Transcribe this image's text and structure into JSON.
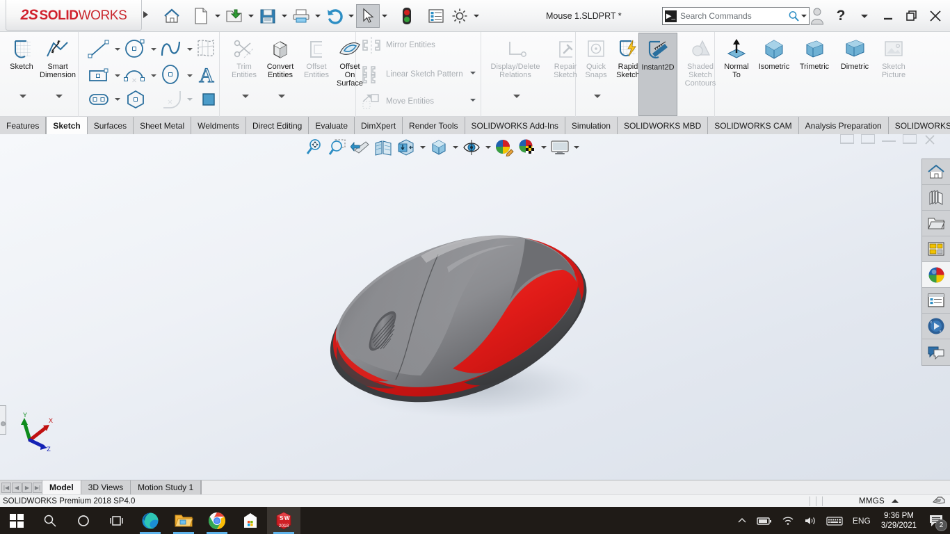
{
  "window": {
    "brand_ds": "2S",
    "brand_solid": "SOLID",
    "brand_works": "WORKS",
    "document_title": "Mouse 1.SLDPRT *",
    "expand_caret": "expand-caret"
  },
  "quick_access": {
    "items": [
      {
        "name": "home-button",
        "label": "Home",
        "dropdown": false
      },
      {
        "name": "new-document-button",
        "label": "New",
        "dropdown": true
      },
      {
        "name": "open-document-button",
        "label": "Open",
        "dropdown": true
      },
      {
        "name": "save-button",
        "label": "Save",
        "dropdown": true
      },
      {
        "name": "print-button",
        "label": "Print",
        "dropdown": true
      },
      {
        "name": "undo-button",
        "label": "Undo",
        "dropdown": true
      },
      {
        "name": "select-button",
        "label": "Select",
        "dropdown": true
      },
      {
        "name": "rebuild-button",
        "label": "Rebuild",
        "dropdown": false
      },
      {
        "name": "options-list-button",
        "label": "File Properties",
        "dropdown": false
      },
      {
        "name": "settings-button",
        "label": "Options",
        "dropdown": true
      }
    ]
  },
  "search": {
    "placeholder": "Search Commands",
    "icon": "command-prompt-icon",
    "magnifier": "magnifier-icon"
  },
  "titlebar_right": {
    "account": "user-account-icon",
    "help": "?",
    "minimize": "minimize-button",
    "restore": "restore-button",
    "close": "close-button"
  },
  "ribbon": {
    "groups": [
      {
        "name": "sketch-group",
        "commands": [
          {
            "label": "Sketch",
            "icon": "sketch-icon",
            "enabled": true,
            "more": true
          },
          {
            "label": "Smart\nDimension",
            "icon": "smart-dimension-icon",
            "enabled": true,
            "more": true
          }
        ]
      },
      {
        "name": "entities-group",
        "commands": [
          {
            "label": "Line",
            "icon": "line-icon",
            "enabled": true
          },
          {
            "label": "Circle",
            "icon": "circle-icon",
            "enabled": true
          },
          {
            "label": "Spline",
            "icon": "spline-icon",
            "enabled": true
          },
          {
            "label": "Surface Sketch",
            "icon": "surface-sketch-icon",
            "enabled": true
          },
          {
            "label": "Rectangle",
            "icon": "rectangle-icon",
            "enabled": true
          },
          {
            "label": "Arc",
            "icon": "arc-icon",
            "enabled": true
          },
          {
            "label": "Ellipse",
            "icon": "ellipse-icon",
            "enabled": true
          },
          {
            "label": "Text",
            "icon": "text-icon",
            "enabled": true
          },
          {
            "label": "Slot",
            "icon": "slot-icon",
            "enabled": true
          },
          {
            "label": "Polygon",
            "icon": "polygon-icon",
            "enabled": true
          },
          {
            "label": "Fillet",
            "icon": "sketch-fillet-icon",
            "enabled": false
          },
          {
            "label": "Plane",
            "icon": "plane-icon",
            "enabled": true
          }
        ]
      },
      {
        "name": "modify-group",
        "commands": [
          {
            "label": "Trim\nEntities",
            "label_l1": "Trim",
            "label_l2": "Entities",
            "icon": "trim-entities-icon",
            "enabled": false,
            "more": true
          },
          {
            "label_l1": "Convert",
            "label_l2": "Entities",
            "icon": "convert-entities-icon",
            "enabled": true,
            "more": true
          },
          {
            "label_l1": "Offset",
            "label_l2": "Entities",
            "icon": "offset-entities-icon",
            "enabled": false
          },
          {
            "label_l1": "Offset",
            "label_l2": "On",
            "label_l3": "Surface",
            "icon": "offset-on-surface-icon",
            "enabled": true
          }
        ]
      },
      {
        "name": "pattern-group",
        "commands": [
          {
            "label": "Mirror Entities",
            "icon": "mirror-entities-icon",
            "enabled": false
          },
          {
            "label": "Linear Sketch Pattern",
            "icon": "linear-sketch-pattern-icon",
            "enabled": false,
            "dropdown": true
          },
          {
            "label": "Move Entities",
            "icon": "move-entities-icon",
            "enabled": false,
            "dropdown": true
          }
        ]
      },
      {
        "name": "relations-group",
        "commands": [
          {
            "label_l1": "Display/Delete",
            "label_l2": "Relations",
            "icon": "display-delete-relations-icon",
            "enabled": false,
            "more": true
          },
          {
            "label_l1": "Repair",
            "label_l2": "Sketch",
            "icon": "repair-sketch-icon",
            "enabled": false
          }
        ]
      },
      {
        "name": "tools-group",
        "commands": [
          {
            "label_l1": "Quick",
            "label_l2": "Snaps",
            "icon": "quick-snaps-icon",
            "enabled": false,
            "more": true
          },
          {
            "label_l1": "Rapid",
            "label_l2": "Sketch",
            "icon": "rapid-sketch-icon",
            "enabled": true
          },
          {
            "label_l1": "Instant2D",
            "icon": "instant2d-icon",
            "enabled": true,
            "selected": true
          },
          {
            "label_l1": "Shaded",
            "label_l2": "Sketch",
            "label_l3": "Contours",
            "icon": "shaded-sketch-contours-icon",
            "enabled": false
          }
        ]
      },
      {
        "name": "view-group",
        "commands": [
          {
            "label_l1": "Normal",
            "label_l2": "To",
            "icon": "normal-to-icon",
            "enabled": true
          },
          {
            "label_l1": "Isometric",
            "icon": "isometric-icon",
            "enabled": true
          },
          {
            "label_l1": "Trimetric",
            "icon": "trimetric-icon",
            "enabled": true
          },
          {
            "label_l1": "Dimetric",
            "icon": "dimetric-icon",
            "enabled": true
          },
          {
            "label_l1": "Sketch",
            "label_l2": "Picture",
            "icon": "sketch-picture-icon",
            "enabled": false
          }
        ]
      }
    ]
  },
  "tabs": {
    "active": "Sketch",
    "items": [
      "Features",
      "Sketch",
      "Surfaces",
      "Sheet Metal",
      "Weldments",
      "Direct Editing",
      "Evaluate",
      "DimXpert",
      "Render Tools",
      "SOLIDWORKS Add-Ins",
      "Simulation",
      "SOLIDWORKS MBD",
      "SOLIDWORKS CAM",
      "Analysis Preparation",
      "SOLIDWORKS Inspection"
    ]
  },
  "view_toolbar": {
    "items": [
      {
        "name": "zoom-to-fit-icon",
        "label": "Zoom to Fit",
        "dropdown": false
      },
      {
        "name": "zoom-to-area-icon",
        "label": "Zoom to Area",
        "dropdown": false
      },
      {
        "name": "previous-view-icon",
        "label": "Previous View",
        "dropdown": false
      },
      {
        "name": "section-view-icon",
        "label": "Section View",
        "dropdown": false
      },
      {
        "name": "view-orientation-icon",
        "label": "View Orientation",
        "dropdown": false
      },
      {
        "name": "display-style-icon",
        "label": "Display Style",
        "dropdown": true
      },
      {
        "name": "hide-show-items-icon",
        "label": "Hide/Show Items",
        "dropdown": true
      },
      {
        "name": "edit-appearance-icon",
        "label": "Edit Appearance",
        "dropdown": false
      },
      {
        "name": "apply-scene-icon",
        "label": "Apply Scene",
        "dropdown": true
      },
      {
        "name": "view-settings-icon",
        "label": "View Settings",
        "dropdown": true
      }
    ]
  },
  "task_pane": {
    "items": [
      {
        "name": "solidworks-resources-icon",
        "label": "SOLIDWORKS Resources"
      },
      {
        "name": "design-library-icon",
        "label": "Design Library"
      },
      {
        "name": "file-explorer-icon",
        "label": "File Explorer"
      },
      {
        "name": "view-palette-icon",
        "label": "View Palette"
      },
      {
        "name": "appearances-scenes-icon",
        "label": "Appearances, Scenes and Decals",
        "selected": true
      },
      {
        "name": "custom-properties-icon",
        "label": "Custom Properties"
      },
      {
        "name": "solidworks-forum-icon",
        "label": "SOLIDWORKS Forum"
      },
      {
        "name": "comments-icon",
        "label": "Comments"
      }
    ]
  },
  "graphics": {
    "triad_labels": {
      "x": "X",
      "y": "Y",
      "z": "Z"
    },
    "model_name": "computer-mouse-model",
    "model_colors": {
      "body_grey": "#7f8083",
      "accent_red": "#e01b18",
      "dark_grey": "#4c4d50",
      "shadow": "#b9bfc8"
    }
  },
  "document_bar": {
    "nav": [
      "first",
      "previous",
      "next",
      "last"
    ],
    "tabs": [
      "Model",
      "3D Views",
      "Motion Study 1"
    ],
    "active": "Model"
  },
  "status_bar": {
    "text": "SOLIDWORKS Premium 2018 SP4.0",
    "units": "MMGS",
    "units_caret": "units-caret",
    "edit_icon": "edit-document-icon"
  },
  "taskbar": {
    "items": [
      {
        "name": "start-button",
        "label": "Start"
      },
      {
        "name": "search-taskbar-icon",
        "label": "Search"
      },
      {
        "name": "cortana-icon",
        "label": "Cortana"
      },
      {
        "name": "task-view-icon",
        "label": "Task View"
      },
      {
        "name": "microsoft-edge-icon",
        "label": "Microsoft Edge",
        "running": true
      },
      {
        "name": "file-explorer-taskbar-icon",
        "label": "File Explorer",
        "running": true
      },
      {
        "name": "google-chrome-icon",
        "label": "Google Chrome",
        "running": true
      },
      {
        "name": "microsoft-store-icon",
        "label": "Microsoft Store"
      },
      {
        "name": "solidworks-taskbar-icon",
        "label": "SOLIDWORKS 2018",
        "running": true,
        "active": true
      }
    ],
    "sw_badge_year": "2018",
    "tray": {
      "show_hidden": "show-hidden-icons-chevron",
      "battery": "battery-icon",
      "network": "wifi-icon",
      "volume": "volume-icon",
      "keyboard": "keyboard-icon",
      "language": "ENG",
      "time": "9:36 PM",
      "date": "3/29/2021",
      "notifications_count": "2"
    }
  }
}
